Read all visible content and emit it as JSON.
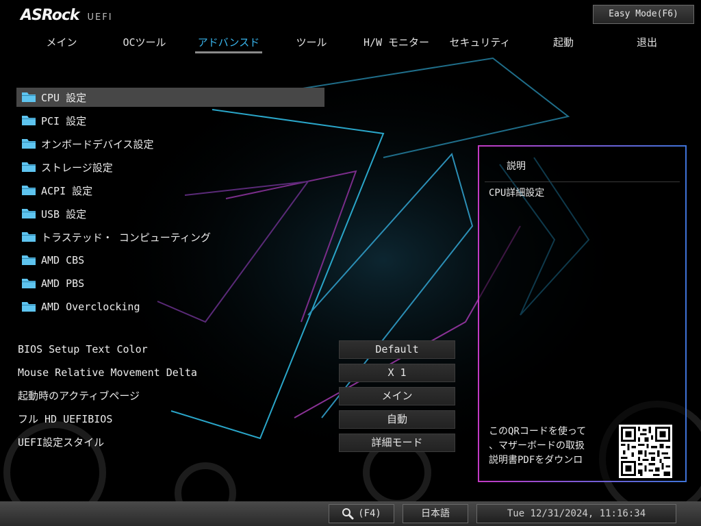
{
  "header": {
    "brand": "ASRock",
    "subtitle": "UEFI",
    "easy_mode_label": "Easy Mode(F6)"
  },
  "tabs": [
    {
      "label": "メイン"
    },
    {
      "label": "OCツール"
    },
    {
      "label": "アドバンスド",
      "active": true
    },
    {
      "label": "ツール"
    },
    {
      "label": "H/W モニター"
    },
    {
      "label": "セキュリティ"
    },
    {
      "label": "起動"
    },
    {
      "label": "退出"
    }
  ],
  "menu": {
    "items": [
      {
        "label": "CPU 設定",
        "icon": "folder-icon",
        "selected": true
      },
      {
        "label": "PCI 設定",
        "icon": "folder-icon"
      },
      {
        "label": "オンボードデバイス設定",
        "icon": "folder-icon"
      },
      {
        "label": "ストレージ設定",
        "icon": "folder-icon"
      },
      {
        "label": "ACPI 設定",
        "icon": "folder-icon"
      },
      {
        "label": "USB 設定",
        "icon": "folder-icon"
      },
      {
        "label": "トラステッド・ コンピューティング",
        "icon": "folder-icon"
      },
      {
        "label": "AMD CBS",
        "icon": "folder-icon"
      },
      {
        "label": "AMD PBS",
        "icon": "folder-icon"
      },
      {
        "label": "AMD Overclocking",
        "icon": "folder-icon"
      }
    ]
  },
  "settings": [
    {
      "label": "BIOS Setup Text Color",
      "value": "Default"
    },
    {
      "label": "Mouse Relative Movement Delta",
      "value": "X 1"
    },
    {
      "label": "起動時のアクティブページ",
      "value": "メイン"
    },
    {
      "label": "フル HD UEFIBIOS",
      "value": "自動"
    },
    {
      "label": "UEFI設定スタイル",
      "value": "詳細モード"
    }
  ],
  "description": {
    "title": "説明",
    "text": "CPU詳細設定",
    "qr_text": "このQRコードを使って\n、マザーボードの取扱\n説明書PDFをダウンロ"
  },
  "bottom": {
    "search_label": "(F4)",
    "language": "日本語",
    "datetime": "Tue 12/31/2024, 11:16:34"
  },
  "colors": {
    "accent_blue": "#39b6ee",
    "selected_row": "#474747",
    "panel_border_magenta": "#c23ac4",
    "panel_border_blue": "#3f73d8"
  }
}
